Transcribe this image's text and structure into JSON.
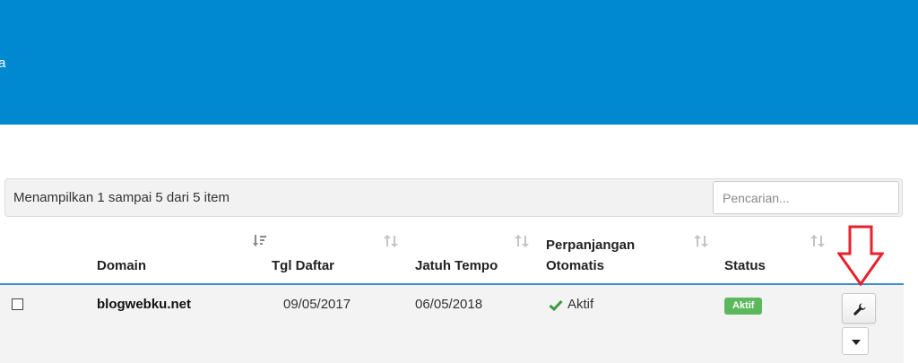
{
  "banner": {
    "text": "a",
    "color": "#0089d0"
  },
  "toolbar": {
    "info": "Menampilkan 1 sampai 5 dari 5 item",
    "search_placeholder": "Pencarian..."
  },
  "table": {
    "columns": {
      "domain": "Domain",
      "reg_date": "Tgl Daftar",
      "due_date": "Jatuh Tempo",
      "auto_renew_line1": "Perpanjangan",
      "auto_renew_line2": "Otomatis",
      "status": "Status"
    },
    "rows": [
      {
        "domain": "blogwebku.net",
        "reg_date": "09/05/2017",
        "due_date": "06/05/2018",
        "auto_renew": "Aktif",
        "status": "Aktif",
        "status_color": "#5cb85c"
      }
    ],
    "header_line_color": "#3a8fcf"
  },
  "icons": {
    "sort_active": "sort-amount-icon",
    "sort": "sort-arrows-icon",
    "auto_renew": "check-icon",
    "manage": "wrench-icon",
    "menu": "caret-down-icon",
    "annotation": "red-arrow-down-icon"
  },
  "annotation_color": "#e8212b"
}
